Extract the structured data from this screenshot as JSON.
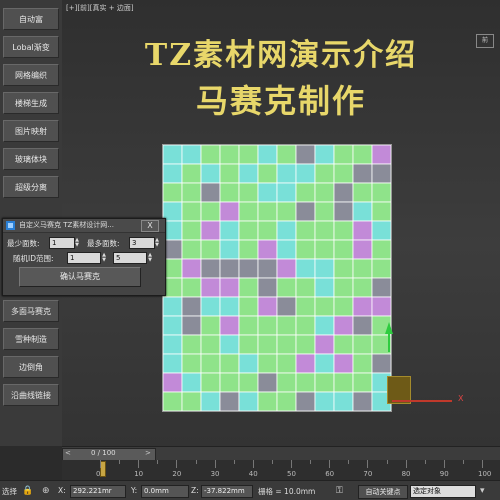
{
  "sidebar": {
    "items": [
      {
        "label": "自动富"
      },
      {
        "label": "Lobal渐变"
      },
      {
        "label": "网格编织"
      },
      {
        "label": "楼梯生成"
      },
      {
        "label": "图片映射"
      },
      {
        "label": "玻璃体块"
      },
      {
        "label": "超级分离"
      },
      {
        "label": "多面马赛克"
      },
      {
        "label": "雪种制造"
      },
      {
        "label": "边倒角"
      },
      {
        "label": "沿曲线链接"
      }
    ]
  },
  "viewport": {
    "label": "[+][前][真实 + 边面]",
    "corner_box": "前",
    "title_line1": "TZ素材网演示介绍",
    "title_line2": "马赛克制作",
    "axis_x_label": "X",
    "mosaic_colors": [
      "#8fe38a",
      "#79e0d8",
      "#c28ad8",
      "#8a8c99"
    ]
  },
  "dialog": {
    "title": "自定义马赛克 TZ素材设计网...",
    "close_label": "X",
    "min_faces_label": "最少面数:",
    "min_faces_value": "1",
    "max_faces_label": "最多面数:",
    "max_faces_value": "3",
    "random_id_label": "随机ID范围:",
    "random_id_from": "1",
    "random_id_to": "5",
    "confirm_label": "确认马赛克"
  },
  "timeline": {
    "position_text": "0 / 100",
    "prev_arrow": "<",
    "next_arrow": ">",
    "ruler_labels": [
      "0",
      "10",
      "20",
      "30",
      "40",
      "50",
      "60",
      "70",
      "80",
      "90",
      "100"
    ]
  },
  "statusbar": {
    "select_text": "选择",
    "x_label": "X:",
    "x_value": "292.221mr",
    "y_label": "Y:",
    "y_value": "0.0mm",
    "z_label": "Z:",
    "z_value": "-37.822mm",
    "grid_text": "栅格 = 10.0mm",
    "auto_key_label": "自动关键点",
    "selection_set": "选定对象"
  }
}
